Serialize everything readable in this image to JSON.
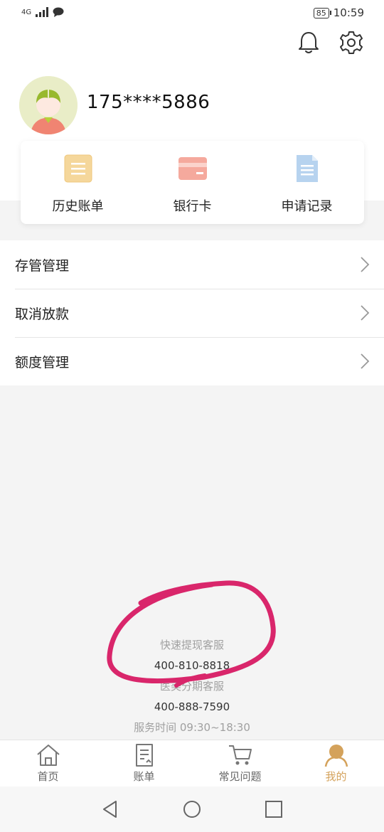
{
  "status_bar": {
    "network": "4G",
    "battery": "85",
    "time": "10:59"
  },
  "header": {
    "icons": {
      "bell": "bell-icon",
      "settings": "gear-icon"
    },
    "phone": "175****5886"
  },
  "quick_actions": [
    {
      "label": "历史账单",
      "icon": "bill-history-icon",
      "color": "#f1cf8c"
    },
    {
      "label": "银行卡",
      "icon": "bank-card-icon",
      "color": "#f29b8f"
    },
    {
      "label": "申请记录",
      "icon": "application-record-icon",
      "color": "#a9c9ec"
    }
  ],
  "menu": [
    {
      "label": "存管管理"
    },
    {
      "label": "取消放款"
    },
    {
      "label": "额度管理"
    }
  ],
  "contact": {
    "line1": "快速提现客服",
    "phone1": "400-810-8818",
    "line2": "医美分期客服",
    "phone2": "400-888-7590",
    "hours": "服务时间 09:30~18:30"
  },
  "tabs": [
    {
      "label": "首页",
      "icon": "home-icon",
      "active": false
    },
    {
      "label": "账单",
      "icon": "bill-icon",
      "active": false
    },
    {
      "label": "常见问题",
      "icon": "cart-icon",
      "active": false
    },
    {
      "label": "我的",
      "icon": "user-icon",
      "active": true
    }
  ],
  "colors": {
    "accent": "#d4a25b",
    "annotation": "#d9266b"
  }
}
